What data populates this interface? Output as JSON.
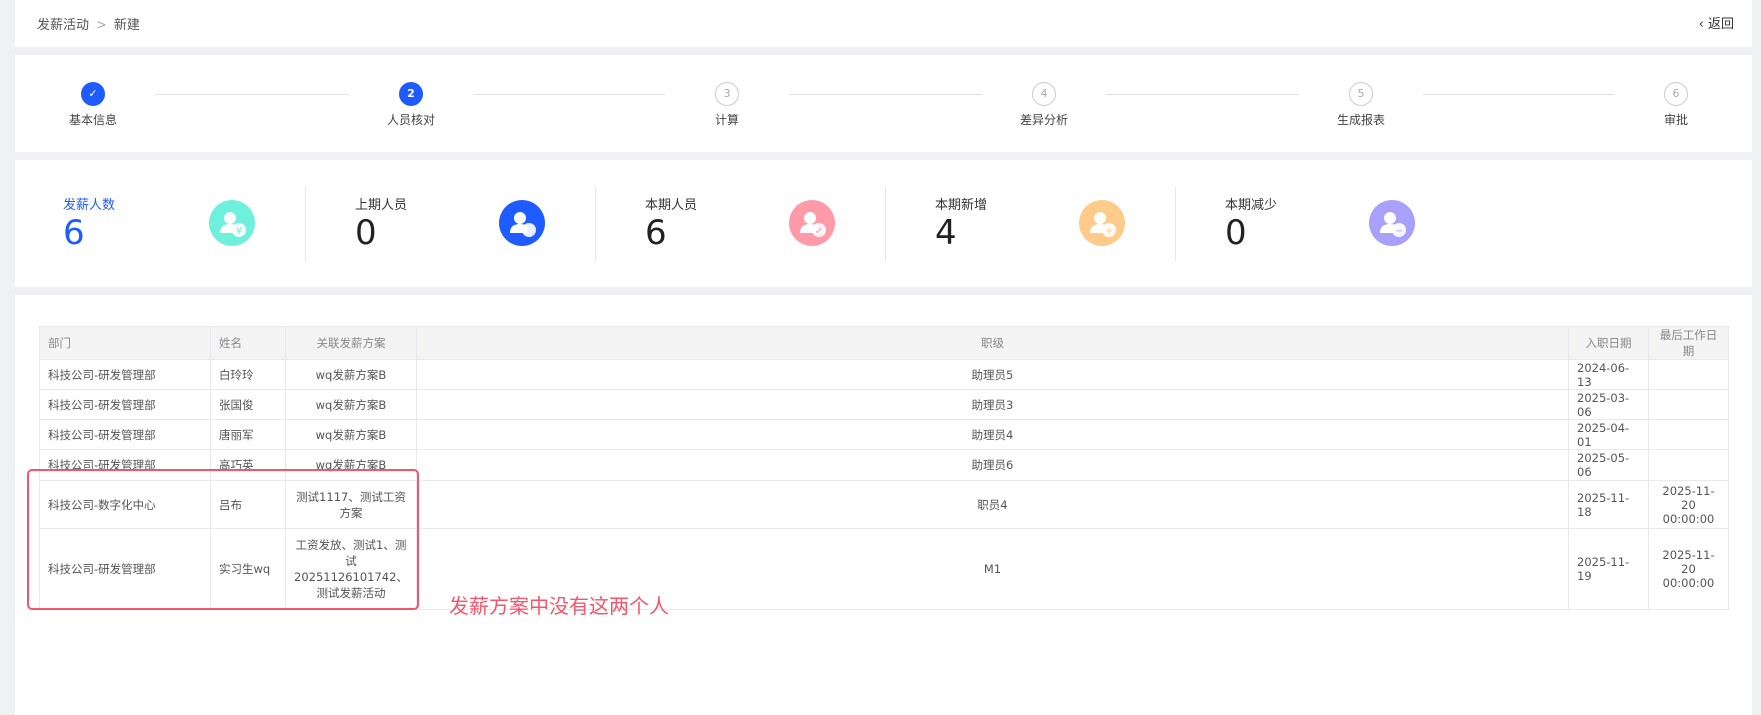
{
  "breadcrumb": [
    "发薪活动",
    "新建"
  ],
  "back_label": "返回",
  "steps": [
    {
      "num": "1",
      "label": "基本信息",
      "status": "done"
    },
    {
      "num": "2",
      "label": "人员核对",
      "status": "active"
    },
    {
      "num": "3",
      "label": "计算",
      "status": "pending"
    },
    {
      "num": "4",
      "label": "差异分析",
      "status": "pending"
    },
    {
      "num": "5",
      "label": "生成报表",
      "status": "pending"
    },
    {
      "num": "6",
      "label": "审批",
      "status": "pending"
    }
  ],
  "stats": [
    {
      "label": "发薪人数",
      "value": "6",
      "icon": "user-yen-icon",
      "color": "#6ef0dc"
    },
    {
      "label": "上期人员",
      "value": "0",
      "icon": "users-icon",
      "color": "#1f5cff"
    },
    {
      "label": "本期人员",
      "value": "6",
      "icon": "user-check-icon",
      "color": "#ff9aa8"
    },
    {
      "label": "本期新增",
      "value": "4",
      "icon": "user-plus-icon",
      "color": "#ffcb8a"
    },
    {
      "label": "本期减少",
      "value": "0",
      "icon": "user-minus-icon",
      "color": "#a8a0fa"
    }
  ],
  "table": {
    "headers": [
      "部门",
      "姓名",
      "关联发薪方案",
      "职级",
      "入职日期",
      "最后工作日期"
    ],
    "rows": [
      [
        "科技公司-研发管理部",
        "白玲玲",
        "wq发薪方案B",
        "助理员5",
        "2024-06-13",
        ""
      ],
      [
        "科技公司-研发管理部",
        "张国俊",
        "wq发薪方案B",
        "助理员3",
        "2025-03-06",
        ""
      ],
      [
        "科技公司-研发管理部",
        "唐丽军",
        "wq发薪方案B",
        "助理员4",
        "2025-04-01",
        ""
      ],
      [
        "科技公司-研发管理部",
        "高巧英",
        "wq发薪方案B",
        "助理员6",
        "2025-05-06",
        ""
      ],
      [
        "科技公司-数字化中心",
        "吕布",
        "测试1117、测试工资方案",
        "职员4",
        "2025-11-18",
        "2025-11-20 00:00:00"
      ],
      [
        "科技公司-研发管理部",
        "实习生wq",
        "工资发放、测试1、测试20251126101742、测试发薪活动",
        "M1",
        "2025-11-19",
        "2025-11-20 00:00:00"
      ]
    ]
  },
  "annotation": "发薪方案中没有这两个人",
  "colors": {
    "primary": "#1f5cff",
    "annotation": "#f0576a"
  }
}
